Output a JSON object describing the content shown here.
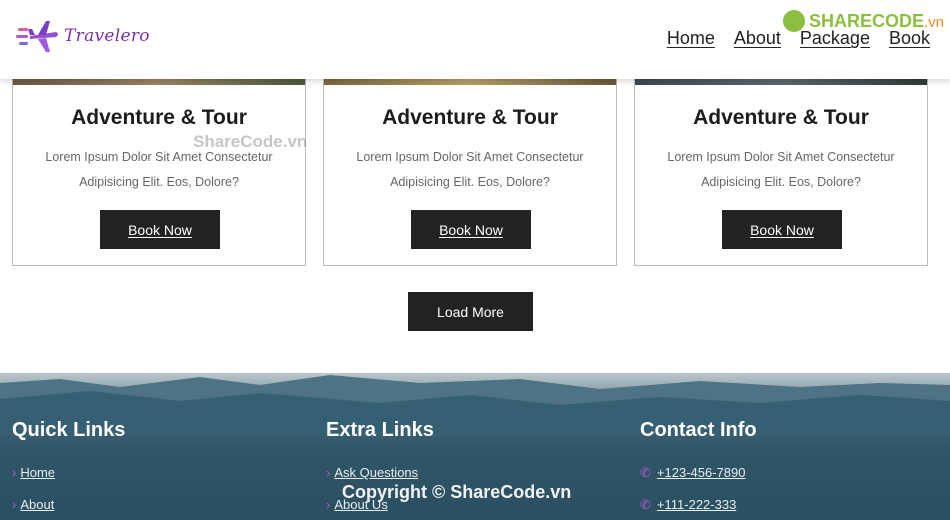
{
  "header": {
    "logo_text": "Travelero",
    "nav": [
      "Home",
      "About",
      "Package",
      "Book"
    ]
  },
  "watermark_top": {
    "brand": "SHARECODE",
    "suffix": ".vn"
  },
  "watermark_mid": "ShareCode.vn",
  "cards": [
    {
      "title": "Adventure & Tour",
      "text": "Lorem Ipsum Dolor Sit Amet Consectetur Adipisicing Elit. Eos, Dolore?",
      "button": "Book Now"
    },
    {
      "title": "Adventure & Tour",
      "text": "Lorem Ipsum Dolor Sit Amet Consectetur Adipisicing Elit. Eos, Dolore?",
      "button": "Book Now"
    },
    {
      "title": "Adventure & Tour",
      "text": "Lorem Ipsum Dolor Sit Amet Consectetur Adipisicing Elit. Eos, Dolore?",
      "button": "Book Now"
    }
  ],
  "load_more": "Load More",
  "footer": {
    "quick_links": {
      "title": "Quick Links",
      "items": [
        "Home",
        "About"
      ]
    },
    "extra_links": {
      "title": "Extra Links",
      "items": [
        "Ask Questions",
        "About Us"
      ]
    },
    "contact": {
      "title": "Contact Info",
      "items": [
        "+123-456-7890",
        "+111-222-333"
      ]
    }
  },
  "copyright": "Copyright © ShareCode.vn",
  "colors": {
    "accent": "#b05ad8",
    "dark": "#222222",
    "logo": "#7b2fa8"
  },
  "icons": [
    "plane-logo-icon",
    "chevron-right-icon",
    "phone-icon"
  ]
}
